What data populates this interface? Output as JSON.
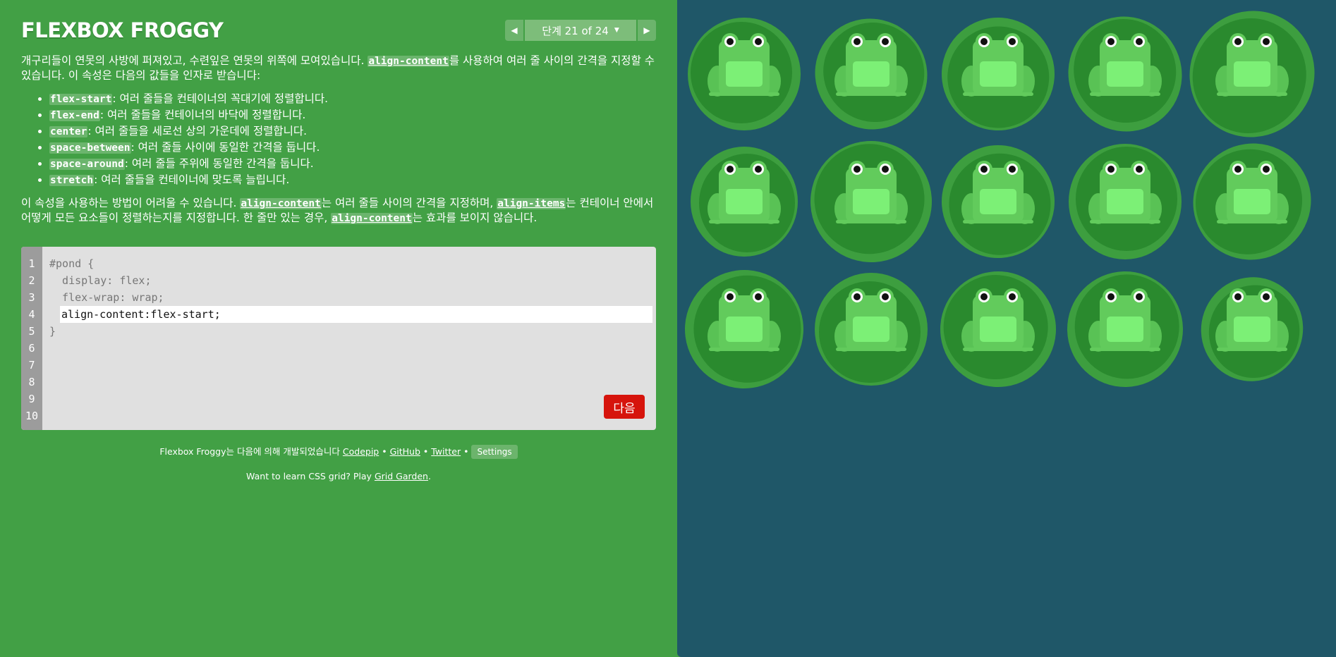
{
  "header": {
    "title": "FLEXBOX FROGGY",
    "level_label": "단계 21 of 24",
    "prev_icon": "triangle-left-icon",
    "next_icon": "triangle-right-icon",
    "dropdown_icon": "caret-down-icon"
  },
  "instructions": {
    "p1_before": "개구리들이 연못의 사방에 퍼져있고, 수련잎은 연못의 위쪽에 모여있습니다. ",
    "p1_code": "align-content",
    "p1_after": "를 사용하여 여러 줄 사이의 간격을 지정할 수 있습니다. 이 속성은 다음의 값들을 인자로 받습니다:",
    "items": [
      {
        "code": "flex-start",
        "text": ": 여러 줄들을 컨테이너의 꼭대기에 정렬합니다."
      },
      {
        "code": "flex-end",
        "text": ": 여러 줄들을 컨테이너의 바닥에 정렬합니다."
      },
      {
        "code": "center",
        "text": ": 여러 줄들을 세로선 상의 가운데에 정렬합니다."
      },
      {
        "code": "space-between",
        "text": ": 여러 줄들 사이에 동일한 간격을 둡니다."
      },
      {
        "code": "space-around",
        "text": ": 여러 줄들 주위에 동일한 간격을 둡니다."
      },
      {
        "code": "stretch",
        "text": ": 여러 줄들을 컨테이너에 맞도록 늘립니다."
      }
    ],
    "p2_a": "이 속성을 사용하는 방법이 어려울 수 있습니다. ",
    "p2_code1": "align-content",
    "p2_b": "는 여러 줄들 사이의 간격을 지정하며, ",
    "p2_code2": "align-items",
    "p2_c": "는 컨테이너 안에서 어떻게 모든 요소들이 정렬하는지를 지정합니다. 한 줄만 있는 경우, ",
    "p2_code3": "align-content",
    "p2_d": "는 효과를 보이지 않습니다."
  },
  "editor": {
    "line_numbers": [
      "1",
      "2",
      "3",
      "4",
      "5",
      "6",
      "7",
      "8",
      "9",
      "10"
    ],
    "line1": "#pond {",
    "line2": "  display: flex;",
    "line3": "  flex-wrap: wrap;",
    "input_value": "align-content:flex-start;",
    "line5": "}",
    "next_label": "다음"
  },
  "footer": {
    "credits_prefix": "Flexbox Froggy는 다음에 의해 개발되었습니다 ",
    "codepip": "Codepip",
    "sep": " • ",
    "github": "GitHub",
    "twitter": "Twitter",
    "settings": "Settings",
    "grid_prefix": "Want to learn CSS grid? Play ",
    "grid_link": "Grid Garden",
    "grid_suffix": "."
  },
  "colors": {
    "background_left": "#42a045",
    "pond": "#1f5768",
    "lilypad": "#2a8a2e",
    "lilypad_rim": "#3d9e3f",
    "frog_body": "#62cb5c",
    "frog_belly": "#7cf076",
    "next_button": "#d6140c"
  },
  "pond": {
    "frog_count": 15
  }
}
